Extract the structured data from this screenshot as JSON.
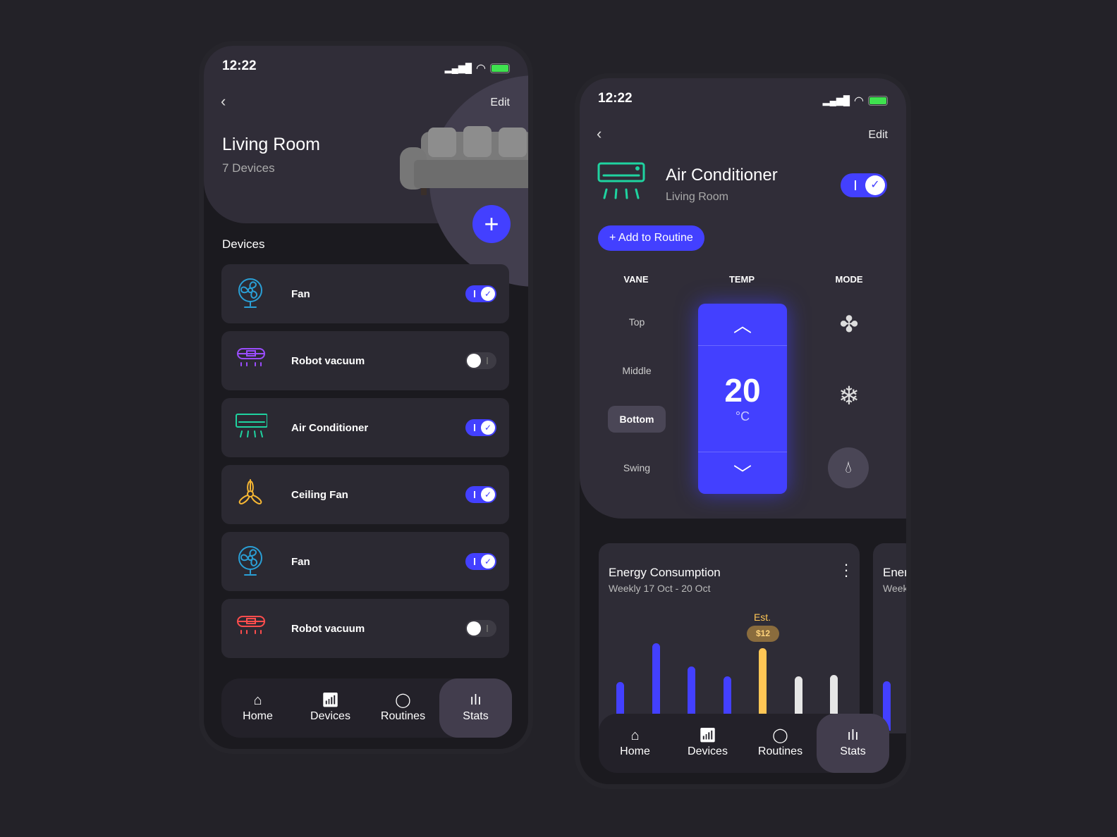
{
  "status": {
    "time": "12:22"
  },
  "room": {
    "back": "‹",
    "edit": "Edit",
    "title": "Living Room",
    "subtitle": "7 Devices",
    "section": "Devices",
    "add": "+"
  },
  "devices": [
    {
      "label": "Fan",
      "icon": "fan",
      "color": "#2a9fd6",
      "on": true
    },
    {
      "label": "Robot vacuum",
      "icon": "robot-vacuum",
      "color": "#9b4dff",
      "on": false
    },
    {
      "label": "Air Conditioner",
      "icon": "air-conditioner",
      "color": "#1fd3a0",
      "on": true
    },
    {
      "label": "Ceiling Fan",
      "icon": "ceiling-fan",
      "color": "#f7b733",
      "on": true
    },
    {
      "label": "Fan",
      "icon": "fan",
      "color": "#2a9fd6",
      "on": true
    },
    {
      "label": "Robot vacuum",
      "icon": "robot-vacuum",
      "color": "#ff4d4d",
      "on": false
    }
  ],
  "nav": [
    {
      "label": "Home",
      "icon": "home"
    },
    {
      "label": "Devices",
      "icon": "remote"
    },
    {
      "label": "Routines",
      "icon": "routines"
    },
    {
      "label": "Stats",
      "icon": "stats",
      "active": true
    }
  ],
  "ac": {
    "back": "‹",
    "edit": "Edit",
    "title": "Air Conditioner",
    "subtitle": "Living Room",
    "on": true,
    "add_routine": "+ Add to Routine",
    "vane_header": "VANE",
    "temp_header": "TEMP",
    "mode_header": "MODE",
    "vane_options": [
      "Top",
      "Middle",
      "Bottom",
      "Swing"
    ],
    "vane_selected": "Bottom",
    "temp": "20",
    "unit": "°C",
    "modes": [
      "fan",
      "cool",
      "dry"
    ],
    "mode_selected": "dry"
  },
  "energy": {
    "title": "Energy Consumption",
    "subtitle": "Weekly 17 Oct - 20 Oct",
    "est_label": "Est.",
    "est_value": "$12",
    "peek_title": "Ener",
    "peek_subtitle": "Week"
  },
  "chart_data": {
    "type": "bar",
    "values": [
      45,
      100,
      67,
      53,
      93,
      53,
      55
    ],
    "colors": [
      "#4340ff",
      "#4340ff",
      "#4340ff",
      "#4340ff",
      "#ffc655",
      "#e6e6e6",
      "#e6e6e6"
    ],
    "highlight_index": 4
  },
  "colors": {
    "accent": "#4340ff",
    "estimate": "#ffc655",
    "battery": "#3fe24f"
  }
}
